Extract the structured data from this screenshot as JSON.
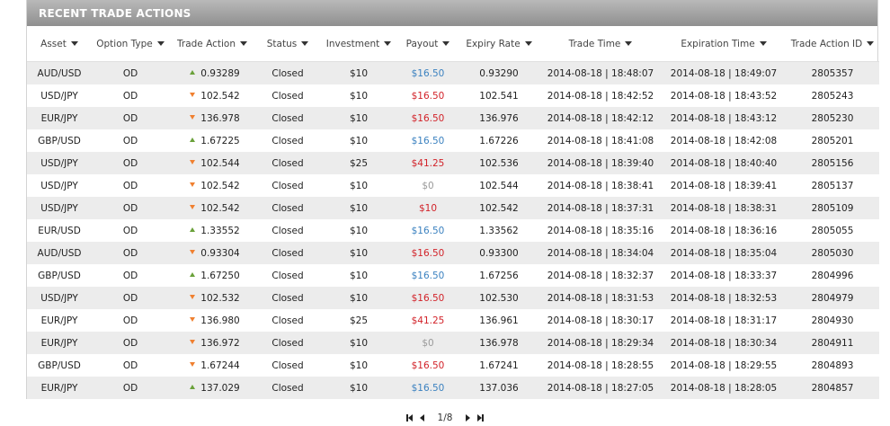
{
  "panel": {
    "title": "RECENT TRADE ACTIONS"
  },
  "columns": [
    {
      "label": "Asset"
    },
    {
      "label": "Option Type"
    },
    {
      "label": "Trade Action"
    },
    {
      "label": "Status"
    },
    {
      "label": "Investment"
    },
    {
      "label": "Payout"
    },
    {
      "label": "Expiry Rate"
    },
    {
      "label": "Trade Time"
    },
    {
      "label": "Expiration Time"
    },
    {
      "label": "Trade Action ID"
    }
  ],
  "colors": {
    "up": "#6aa13a",
    "down": "#f08030",
    "payout_win": "#3c82c0",
    "payout_loss": "#d2232a",
    "payout_zero": "#9a9a9a",
    "header_bg": "#9e9e9e"
  },
  "rows": [
    {
      "asset": "AUD/USD",
      "option_type": "OD",
      "direction": "up",
      "action": "0.93289",
      "status": "Closed",
      "investment": "$10",
      "payout": "$16.50",
      "payout_kind": "win",
      "expiry_rate": "0.93290",
      "trade_time": "2014-08-18 | 18:48:07",
      "expiration_time": "2014-08-18 | 18:49:07",
      "id": "2805357"
    },
    {
      "asset": "USD/JPY",
      "option_type": "OD",
      "direction": "down",
      "action": "102.542",
      "status": "Closed",
      "investment": "$10",
      "payout": "$16.50",
      "payout_kind": "loss",
      "expiry_rate": "102.541",
      "trade_time": "2014-08-18 | 18:42:52",
      "expiration_time": "2014-08-18 | 18:43:52",
      "id": "2805243"
    },
    {
      "asset": "EUR/JPY",
      "option_type": "OD",
      "direction": "down",
      "action": "136.978",
      "status": "Closed",
      "investment": "$10",
      "payout": "$16.50",
      "payout_kind": "loss",
      "expiry_rate": "136.976",
      "trade_time": "2014-08-18 | 18:42:12",
      "expiration_time": "2014-08-18 | 18:43:12",
      "id": "2805230"
    },
    {
      "asset": "GBP/USD",
      "option_type": "OD",
      "direction": "up",
      "action": "1.67225",
      "status": "Closed",
      "investment": "$10",
      "payout": "$16.50",
      "payout_kind": "win",
      "expiry_rate": "1.67226",
      "trade_time": "2014-08-18 | 18:41:08",
      "expiration_time": "2014-08-18 | 18:42:08",
      "id": "2805201"
    },
    {
      "asset": "USD/JPY",
      "option_type": "OD",
      "direction": "down",
      "action": "102.544",
      "status": "Closed",
      "investment": "$25",
      "payout": "$41.25",
      "payout_kind": "loss",
      "expiry_rate": "102.536",
      "trade_time": "2014-08-18 | 18:39:40",
      "expiration_time": "2014-08-18 | 18:40:40",
      "id": "2805156"
    },
    {
      "asset": "USD/JPY",
      "option_type": "OD",
      "direction": "down",
      "action": "102.542",
      "status": "Closed",
      "investment": "$10",
      "payout": "$0",
      "payout_kind": "zero",
      "expiry_rate": "102.544",
      "trade_time": "2014-08-18 | 18:38:41",
      "expiration_time": "2014-08-18 | 18:39:41",
      "id": "2805137"
    },
    {
      "asset": "USD/JPY",
      "option_type": "OD",
      "direction": "down",
      "action": "102.542",
      "status": "Closed",
      "investment": "$10",
      "payout": "$10",
      "payout_kind": "loss",
      "expiry_rate": "102.542",
      "trade_time": "2014-08-18 | 18:37:31",
      "expiration_time": "2014-08-18 | 18:38:31",
      "id": "2805109"
    },
    {
      "asset": "EUR/USD",
      "option_type": "OD",
      "direction": "up",
      "action": "1.33552",
      "status": "Closed",
      "investment": "$10",
      "payout": "$16.50",
      "payout_kind": "win",
      "expiry_rate": "1.33562",
      "trade_time": "2014-08-18 | 18:35:16",
      "expiration_time": "2014-08-18 | 18:36:16",
      "id": "2805055"
    },
    {
      "asset": "AUD/USD",
      "option_type": "OD",
      "direction": "down",
      "action": "0.93304",
      "status": "Closed",
      "investment": "$10",
      "payout": "$16.50",
      "payout_kind": "loss",
      "expiry_rate": "0.93300",
      "trade_time": "2014-08-18 | 18:34:04",
      "expiration_time": "2014-08-18 | 18:35:04",
      "id": "2805030"
    },
    {
      "asset": "GBP/USD",
      "option_type": "OD",
      "direction": "up",
      "action": "1.67250",
      "status": "Closed",
      "investment": "$10",
      "payout": "$16.50",
      "payout_kind": "win",
      "expiry_rate": "1.67256",
      "trade_time": "2014-08-18 | 18:32:37",
      "expiration_time": "2014-08-18 | 18:33:37",
      "id": "2804996"
    },
    {
      "asset": "USD/JPY",
      "option_type": "OD",
      "direction": "down",
      "action": "102.532",
      "status": "Closed",
      "investment": "$10",
      "payout": "$16.50",
      "payout_kind": "loss",
      "expiry_rate": "102.530",
      "trade_time": "2014-08-18 | 18:31:53",
      "expiration_time": "2014-08-18 | 18:32:53",
      "id": "2804979"
    },
    {
      "asset": "EUR/JPY",
      "option_type": "OD",
      "direction": "down",
      "action": "136.980",
      "status": "Closed",
      "investment": "$25",
      "payout": "$41.25",
      "payout_kind": "loss",
      "expiry_rate": "136.961",
      "trade_time": "2014-08-18 | 18:30:17",
      "expiration_time": "2014-08-18 | 18:31:17",
      "id": "2804930"
    },
    {
      "asset": "EUR/JPY",
      "option_type": "OD",
      "direction": "down",
      "action": "136.972",
      "status": "Closed",
      "investment": "$10",
      "payout": "$0",
      "payout_kind": "zero",
      "expiry_rate": "136.978",
      "trade_time": "2014-08-18 | 18:29:34",
      "expiration_time": "2014-08-18 | 18:30:34",
      "id": "2804911"
    },
    {
      "asset": "GBP/USD",
      "option_type": "OD",
      "direction": "down",
      "action": "1.67244",
      "status": "Closed",
      "investment": "$10",
      "payout": "$16.50",
      "payout_kind": "loss",
      "expiry_rate": "1.67241",
      "trade_time": "2014-08-18 | 18:28:55",
      "expiration_time": "2014-08-18 | 18:29:55",
      "id": "2804893"
    },
    {
      "asset": "EUR/JPY",
      "option_type": "OD",
      "direction": "up",
      "action": "137.029",
      "status": "Closed",
      "investment": "$10",
      "payout": "$16.50",
      "payout_kind": "win",
      "expiry_rate": "137.036",
      "trade_time": "2014-08-18 | 18:27:05",
      "expiration_time": "2014-08-18 | 18:28:05",
      "id": "2804857"
    }
  ],
  "pager": {
    "page_text": "1/8"
  }
}
